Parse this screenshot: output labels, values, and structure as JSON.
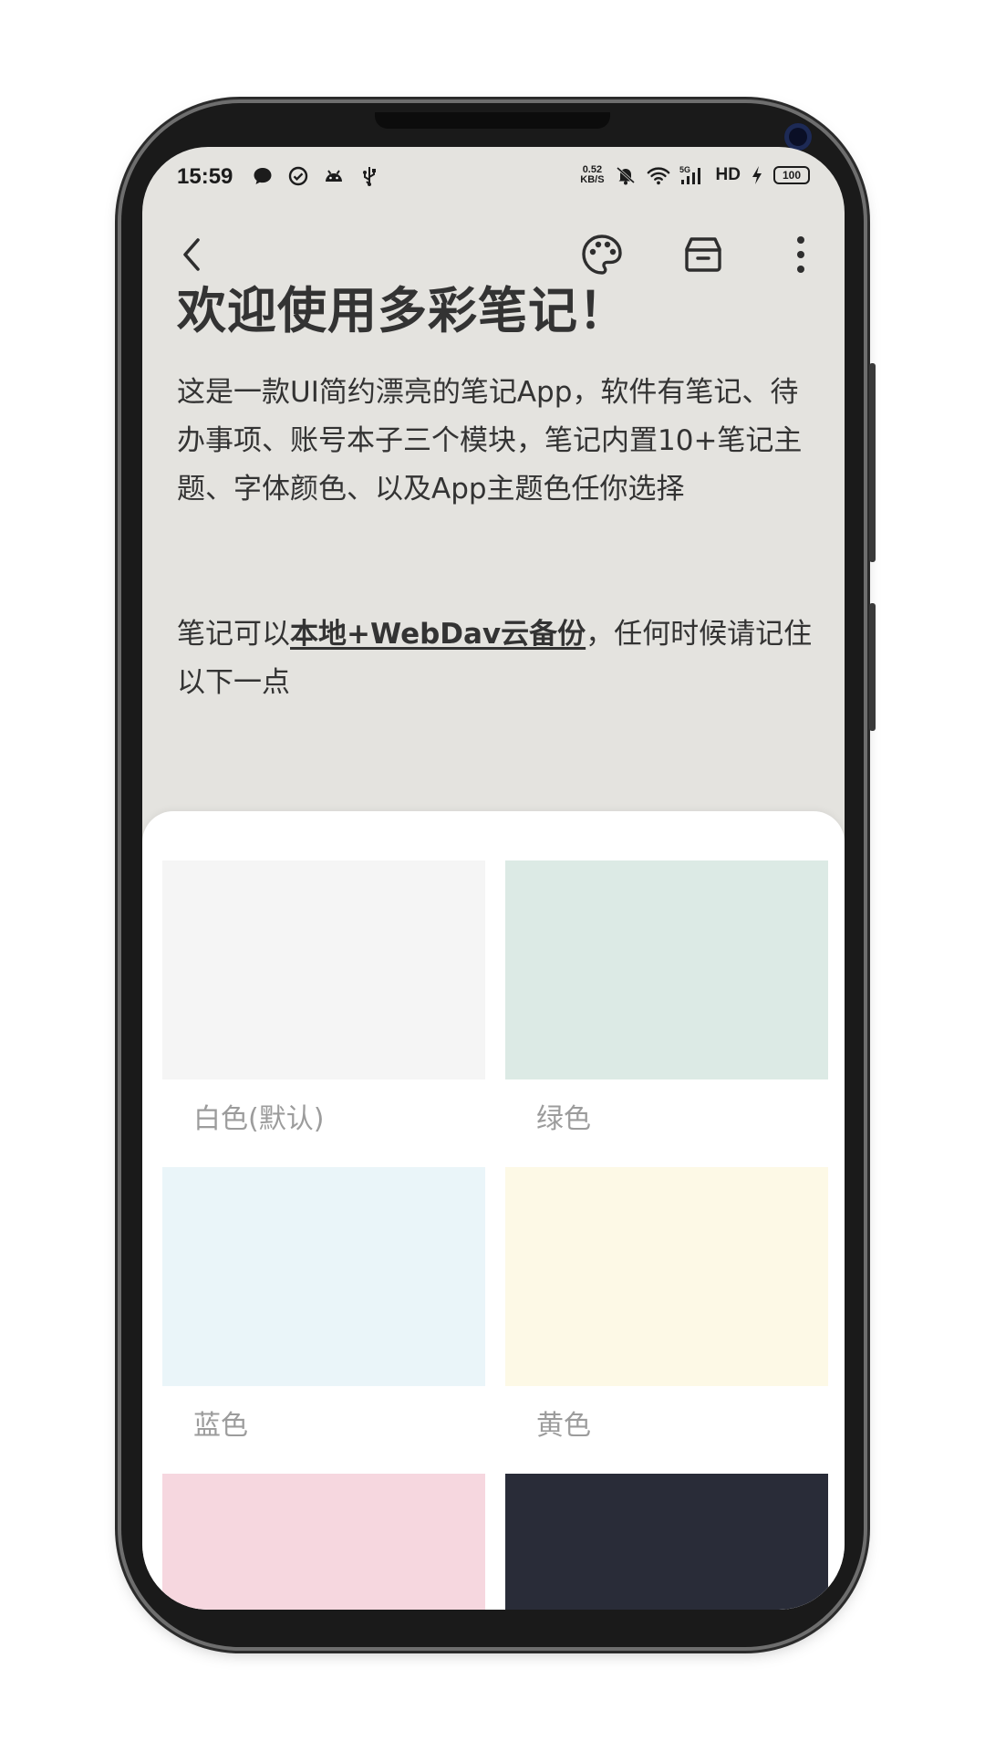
{
  "status_bar": {
    "time": "15:59",
    "net_speed_value": "0.52",
    "net_speed_unit": "KB/S",
    "network_type": "5G",
    "hd_label": "HD",
    "battery": "100"
  },
  "toolbar": {
    "back_icon": "chevron-left-icon",
    "palette_icon": "palette-icon",
    "archive_icon": "archive-icon",
    "more_icon": "more-vertical-icon"
  },
  "note": {
    "title": "欢迎使用多彩笔记！",
    "paragraph1": "这是一款UI简约漂亮的笔记App，软件有笔记、待办事项、账号本子三个模块，笔记内置10+笔记主题、字体颜色、以及App主题色任你选择",
    "paragraph2_prefix": "笔记可以",
    "paragraph2_bold": "本地+WebDav云备份",
    "paragraph2_suffix": "，任何时候请记住以下一点"
  },
  "theme_sheet": {
    "themes": [
      {
        "label": "白色(默认)",
        "color": "#f5f5f5"
      },
      {
        "label": "绿色",
        "color": "#dceae5"
      },
      {
        "label": "蓝色",
        "color": "#eaf5f9"
      },
      {
        "label": "黄色",
        "color": "#fdf9e6"
      },
      {
        "label": "",
        "color": "#f6d7df"
      },
      {
        "label": "",
        "color": "#292c38"
      }
    ]
  },
  "colors": {
    "note_background": "#e4e3df",
    "sheet_background": "#ffffff",
    "text": "#333333",
    "label": "#9c9c9c"
  }
}
